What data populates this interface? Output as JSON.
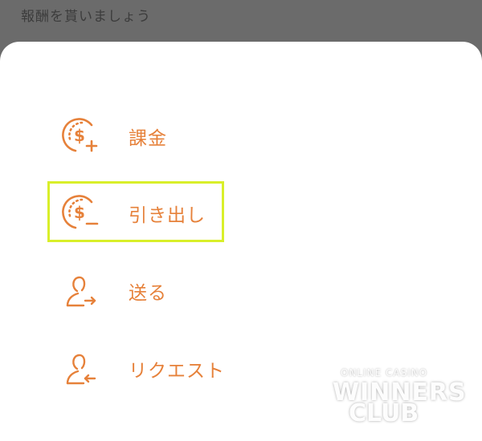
{
  "header": {
    "title": "報酬を貰いましょう"
  },
  "menu": {
    "items": [
      {
        "label": "課金",
        "icon": "coin-plus-icon"
      },
      {
        "label": "引き出し",
        "icon": "coin-minus-icon"
      },
      {
        "label": "送る",
        "icon": "person-send-icon"
      },
      {
        "label": "リクエスト",
        "icon": "person-request-icon"
      }
    ],
    "highlighted_item": "引き出し"
  },
  "colors": {
    "accent": "#e6813a",
    "highlight": "#d9ef2a",
    "overlay": "#6b6b6b",
    "sheet": "#ffffff"
  },
  "watermark": {
    "line1": "ONLINE CASINO",
    "line2": "WINNERS",
    "line3": "CLUB"
  }
}
